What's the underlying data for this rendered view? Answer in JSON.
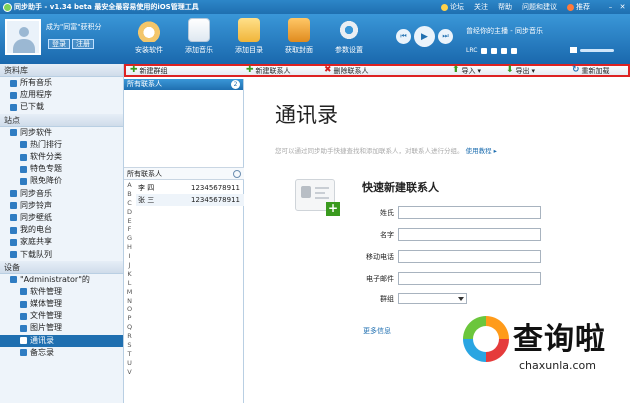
{
  "titlebar": {
    "title": "同步助手 - v1.34 beta  最安全最容易使用的iOS管理工具",
    "links": [
      "论坛",
      "关注",
      "帮助",
      "问题和建议",
      "推荐"
    ]
  },
  "user": {
    "status": "成为\"同富\"获积分",
    "login": "登录",
    "register": "注册"
  },
  "toolbar": [
    {
      "label": "安装软件"
    },
    {
      "label": "添加音乐"
    },
    {
      "label": "添加目录"
    },
    {
      "label": "获取封面"
    },
    {
      "label": "参数设置"
    }
  ],
  "player": {
    "song": "曾经你的主播 - 同步音乐",
    "lrc": "LRC"
  },
  "sidebar": {
    "sections": [
      {
        "title": "资料库",
        "items": [
          {
            "label": "所有音乐",
            "level": 1
          },
          {
            "label": "应用程序",
            "level": 1
          },
          {
            "label": "已下载",
            "level": 1
          }
        ]
      },
      {
        "title": "站点",
        "items": [
          {
            "label": "同步软件",
            "level": 1
          },
          {
            "label": "热门排行",
            "level": 2
          },
          {
            "label": "软件分类",
            "level": 2
          },
          {
            "label": "特色专题",
            "level": 2
          },
          {
            "label": "限免降价",
            "level": 2
          },
          {
            "label": "同步音乐",
            "level": 1
          },
          {
            "label": "同步铃声",
            "level": 1
          },
          {
            "label": "同步壁纸",
            "level": 1
          },
          {
            "label": "我的电台",
            "level": 1
          },
          {
            "label": "家庭共享",
            "level": 1
          },
          {
            "label": "下载队列",
            "level": 1
          }
        ]
      },
      {
        "title": "设备",
        "items": [
          {
            "label": "\"Administrator\"的",
            "level": 1
          },
          {
            "label": "软件管理",
            "level": 2
          },
          {
            "label": "媒体管理",
            "level": 2
          },
          {
            "label": "文件管理",
            "level": 2
          },
          {
            "label": "图片管理",
            "level": 2
          },
          {
            "label": "通讯录",
            "level": 2,
            "selected": true
          },
          {
            "label": "备忘录",
            "level": 2
          }
        ]
      }
    ]
  },
  "actions": {
    "new_group": "新建群组",
    "new_contact": "新建联系人",
    "delete_contact": "删除联系人",
    "import": "导入",
    "export": "导出",
    "reload": "重新加载"
  },
  "contacts_panel": {
    "header": "所有联系人",
    "count": "2",
    "filter": "所有联系人",
    "letters": [
      "A",
      "B",
      "C",
      "D",
      "E",
      "F",
      "G",
      "H",
      "I",
      "J",
      "K",
      "L",
      "M",
      "N",
      "O",
      "P",
      "Q",
      "R",
      "S",
      "T",
      "U",
      "V"
    ],
    "rows": [
      {
        "name": "李 四",
        "phone": "12345678911"
      },
      {
        "name": "张 三",
        "phone": "12345678911"
      }
    ]
  },
  "main": {
    "title": "通讯录",
    "subtitle": "您可以通过同步助手快捷查找和添加联系人，对联系人进行分组。",
    "tutorial": "使用教程",
    "form_title": "快速新建联系人",
    "fields": [
      {
        "label": "姓氏"
      },
      {
        "label": "名字"
      },
      {
        "label": "移动电话"
      },
      {
        "label": "电子邮件"
      }
    ],
    "group_label": "群组",
    "more_info": "更多信息"
  },
  "watermark": {
    "brand": "查询啦",
    "url": "chaxunla.com"
  }
}
